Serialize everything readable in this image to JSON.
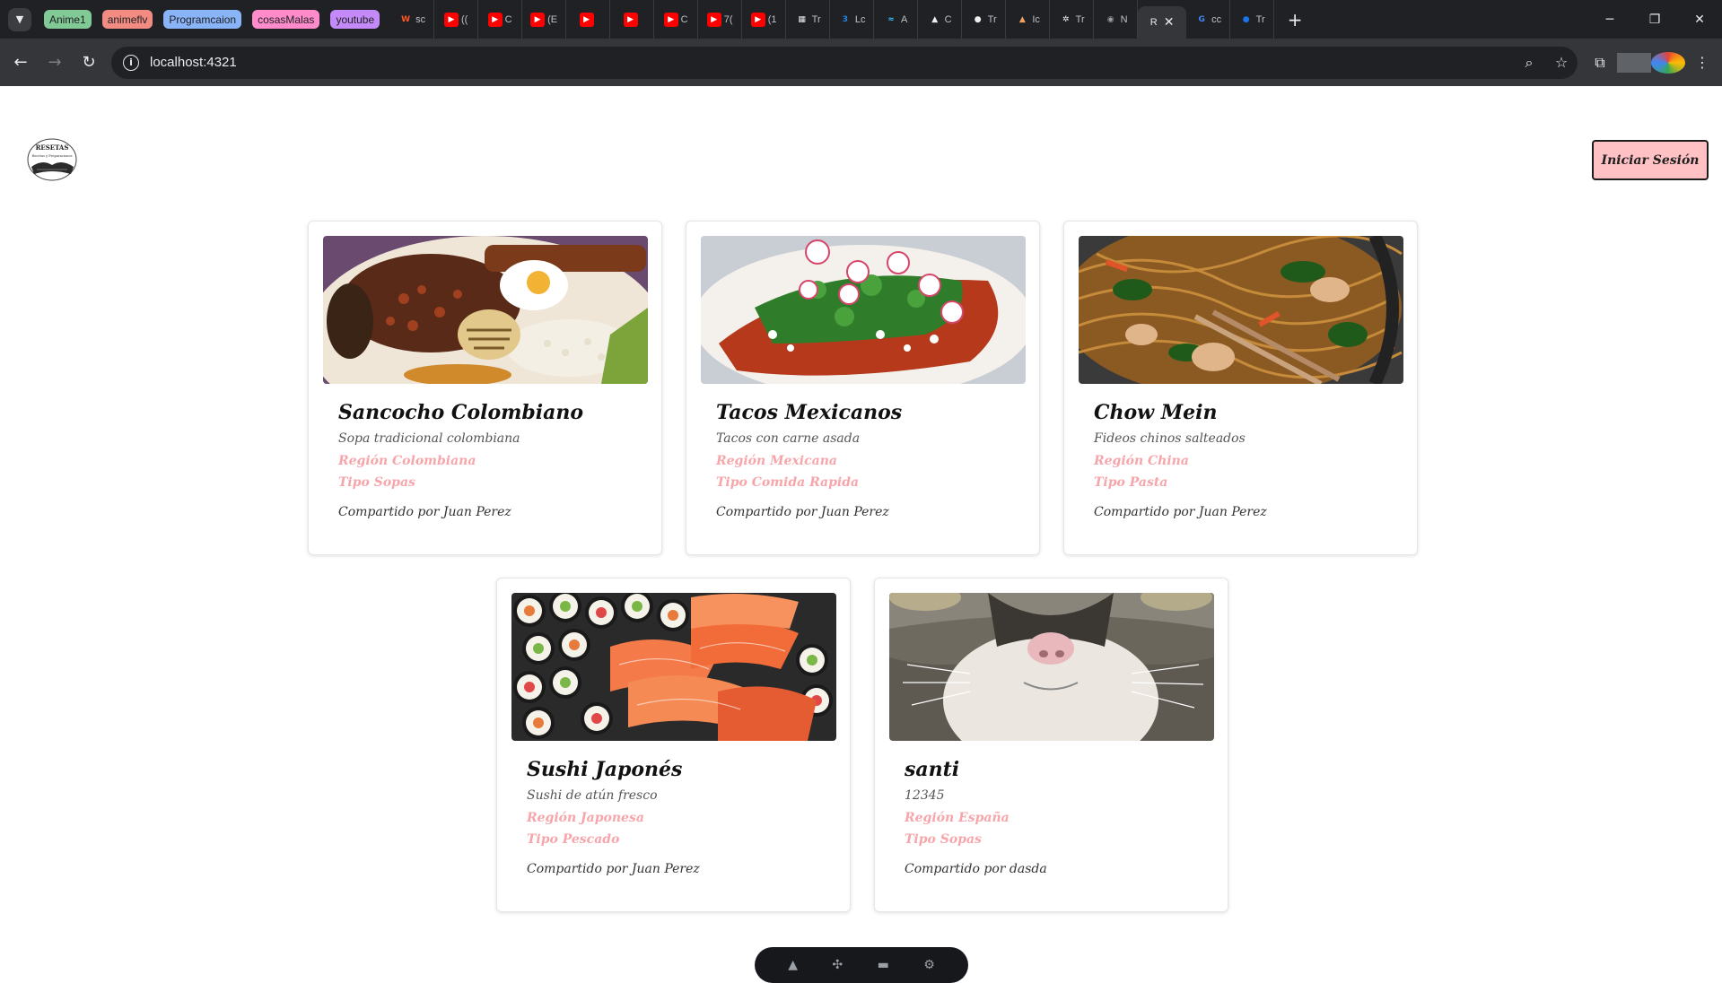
{
  "browser": {
    "tab_groups": [
      {
        "label": "Anime1",
        "color": "#81c995"
      },
      {
        "label": "animeflv",
        "color": "#f28b82"
      },
      {
        "label": "Programcaion",
        "color": "#8ab4f8"
      },
      {
        "label": "cosasMalas",
        "color": "#ff8bcb"
      },
      {
        "label": "youtube",
        "color": "#c58af9"
      }
    ],
    "tabs": [
      {
        "icon": "w-icon",
        "color": "#ff5722",
        "glyph": "W",
        "text": "sc"
      },
      {
        "icon": "youtube-icon",
        "color": "#ff0000",
        "glyph": "▶",
        "text": "(("
      },
      {
        "icon": "youtube-icon",
        "color": "#ff0000",
        "glyph": "▶",
        "text": "C"
      },
      {
        "icon": "youtube-icon",
        "color": "#ff0000",
        "glyph": "▶",
        "text": "(E"
      },
      {
        "icon": "youtube-icon",
        "color": "#ff0000",
        "glyph": "▶",
        "text": ""
      },
      {
        "icon": "youtube-icon",
        "color": "#ff0000",
        "glyph": "▶",
        "text": ""
      },
      {
        "icon": "youtube-icon",
        "color": "#ff0000",
        "glyph": "▶",
        "text": "C"
      },
      {
        "icon": "youtube-icon",
        "color": "#ff0000",
        "glyph": "▶",
        "text": "7("
      },
      {
        "icon": "youtube-icon",
        "color": "#ff0000",
        "glyph": "▶",
        "text": "(1"
      },
      {
        "icon": "doc-icon",
        "color": "#e8eaed",
        "glyph": "▦",
        "text": "Tr"
      },
      {
        "icon": "css-icon",
        "color": "#1e88e5",
        "glyph": "3",
        "text": "Lc"
      },
      {
        "icon": "tailwind-icon",
        "color": "#38bdf8",
        "glyph": "≈",
        "text": "A"
      },
      {
        "icon": "astro-icon",
        "color": "#f0f0f0",
        "glyph": "▲",
        "text": "C"
      },
      {
        "icon": "github-icon",
        "color": "#f0f0f0",
        "glyph": "●",
        "text": "Tr"
      },
      {
        "icon": "bank-icon",
        "color": "#f4a261",
        "glyph": "▲",
        "text": "Ic"
      },
      {
        "icon": "openai-icon",
        "color": "#f0f0f0",
        "glyph": "✲",
        "text": "Tr"
      },
      {
        "icon": "globe-icon",
        "color": "#9aa0a6",
        "glyph": "◉",
        "text": "N"
      }
    ],
    "active_tab": {
      "text": "R"
    },
    "after_tabs": [
      {
        "icon": "google-icon",
        "color": "#4285f4",
        "glyph": "G",
        "text": "cc"
      },
      {
        "icon": "app-icon",
        "color": "#1a73e8",
        "glyph": "●",
        "text": "Tr"
      }
    ],
    "url": "localhost:4321"
  },
  "header": {
    "logo_text": "RESETAS",
    "logo_subtext": "Recetas y Preparaciones",
    "login_label": "Iniciar Sesión"
  },
  "recipes": [
    {
      "title": "Sancocho Colombiano",
      "description": "Sopa tradicional colombiana",
      "region": "Región Colombiana",
      "type": "Tipo Sopas",
      "author": "Compartido por Juan Perez",
      "image": "bandeja-paisa"
    },
    {
      "title": "Tacos Mexicanos",
      "description": "Tacos con carne asada",
      "region": "Región Mexicana",
      "type": "Tipo Comida Rapida",
      "author": "Compartido por Juan Perez",
      "image": "enchiladas"
    },
    {
      "title": "Chow Mein",
      "description": "Fideos chinos salteados",
      "region": "Región China",
      "type": "Tipo Pasta",
      "author": "Compartido por Juan Perez",
      "image": "noodles"
    },
    {
      "title": "Sushi Japonés",
      "description": "Sushi de atún fresco",
      "region": "Región Japonesa",
      "type": "Tipo Pescado",
      "author": "Compartido por Juan Perez",
      "image": "sushi"
    },
    {
      "title": "santi",
      "description": "12345",
      "region": "Región España",
      "type": "Tipo Sopas",
      "author": "Compartido por dasda",
      "image": "cat"
    }
  ]
}
